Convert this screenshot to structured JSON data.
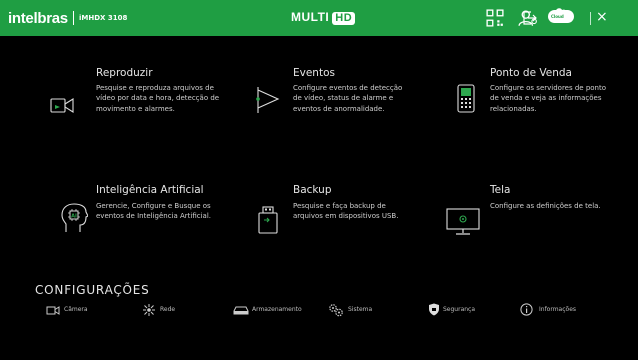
{
  "header": {
    "brand": "intelbras",
    "model": "iMHDX 3108",
    "product_prefix": "MULTI",
    "product_badge": "HD",
    "cloud_label": "Cloud",
    "close_glyph": "×"
  },
  "tiles": [
    {
      "id": "reproduzir",
      "title": "Reproduzir",
      "description": "Pesquise e reproduza arquivos de vídeo por data e hora, detecção de movimento e alarmes.",
      "icon": "playback-icon"
    },
    {
      "id": "eventos",
      "title": "Eventos",
      "description": "Configure eventos de detecção de vídeo, status de alarme e eventos de anormalidade.",
      "icon": "flag-icon"
    },
    {
      "id": "ponto-de-venda",
      "title": "Ponto de Venda",
      "description": "Configure os servidores de ponto de venda e veja as informações relacionadas.",
      "icon": "pos-terminal-icon"
    },
    {
      "id": "inteligencia-artificial",
      "title": "Inteligência Artificial",
      "description": "Gerencie, Configure e Busque os eventos de Inteligência Artificial.",
      "icon": "ai-head-icon"
    },
    {
      "id": "backup",
      "title": "Backup",
      "description": "Pesquise e faça backup de arquivos em dispositivos USB.",
      "icon": "usb-icon"
    },
    {
      "id": "tela",
      "title": "Tela",
      "description": "Configure as definições de tela.",
      "icon": "monitor-icon"
    }
  ],
  "config": {
    "title": "CONFIGURAÇÕES",
    "items": [
      {
        "label": "Câmera",
        "icon": "camera-icon"
      },
      {
        "label": "Rede",
        "icon": "network-icon"
      },
      {
        "label": "Armazenamento",
        "icon": "storage-icon"
      },
      {
        "label": "Sistema",
        "icon": "gears-icon"
      },
      {
        "label": "Segurança",
        "icon": "shield-icon"
      },
      {
        "label": "Informações",
        "icon": "info-icon"
      }
    ]
  },
  "colors": {
    "topbar": "#1f9e43",
    "background": "#000000",
    "icon_green": "#2ea84f"
  }
}
